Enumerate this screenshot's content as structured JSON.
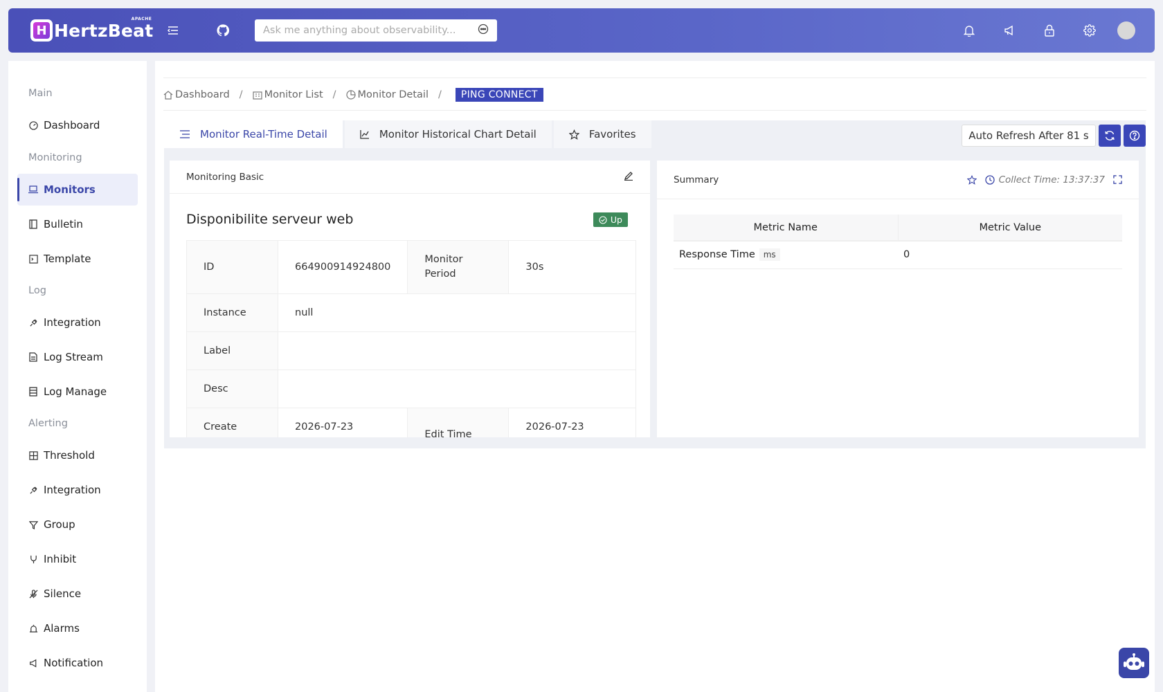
{
  "header": {
    "brand": "HertzBeat",
    "brand_small": "APACHE",
    "logo_letter": "H",
    "search_placeholder": "Ask me anything about observability...",
    "icons": [
      "menu-icon",
      "github-icon",
      "bell-icon",
      "megaphone-icon",
      "lock-icon",
      "gear-icon"
    ]
  },
  "sidebar": {
    "groups": {
      "main": "Main",
      "monitoring": "Monitoring",
      "log": "Log",
      "alerting": "Alerting"
    },
    "items": {
      "dashboard": "Dashboard",
      "monitors": "Monitors",
      "bulletin": "Bulletin",
      "template": "Template",
      "log_integration": "Integration",
      "log_stream": "Log Stream",
      "log_manage": "Log Manage",
      "threshold": "Threshold",
      "alert_integration": "Integration",
      "group": "Group",
      "inhibit": "Inhibit",
      "silence": "Silence",
      "alarms": "Alarms",
      "notification": "Notification"
    }
  },
  "breadcrumb": {
    "dashboard": "Dashboard",
    "monitor_list": "Monitor List",
    "monitor_detail": "Monitor Detail",
    "separator": "/",
    "current": "PING CONNECT"
  },
  "tabs": {
    "realtime": "Monitor Real-Time Detail",
    "history": "Monitor Historical Chart Detail",
    "favorites": "Favorites"
  },
  "toolbar": {
    "auto_refresh": "Auto Refresh After 81 s"
  },
  "basic": {
    "title": "Monitoring Basic",
    "name": "Disponibilite serveur web",
    "status": "Up",
    "labels": {
      "id": "ID",
      "period": "Monitor Period",
      "instance": "Instance",
      "label": "Label",
      "desc": "Desc",
      "create": "Create",
      "edit_time": "Edit Time"
    },
    "values": {
      "id": "664900914924800",
      "period": "30s",
      "instance": "null",
      "label": "",
      "desc": "",
      "create": "2026-07-23",
      "edit_time": "2026-07-23"
    }
  },
  "summary": {
    "title": "Summary",
    "collect_time": "Collect Time: 13:37:37",
    "col_name": "Metric Name",
    "col_value": "Metric Value",
    "rows": [
      {
        "name": "Response Time",
        "unit": "ms",
        "value": "0"
      }
    ]
  },
  "colors": {
    "brand": "#4a50b8",
    "accent": "#3a46b8",
    "status_up": "#3d8a5a"
  }
}
